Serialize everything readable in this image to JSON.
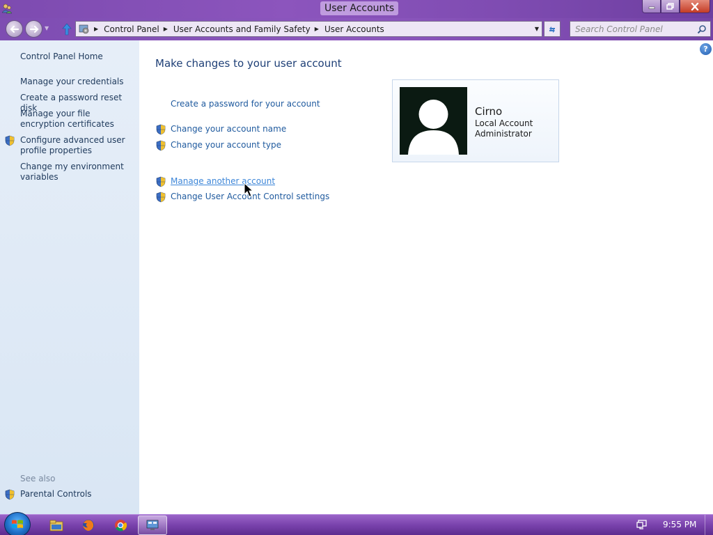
{
  "window": {
    "title": "User Accounts"
  },
  "navigation": {
    "breadcrumbs": [
      "Control Panel",
      "User Accounts and Family Safety",
      "User Accounts"
    ],
    "search_placeholder": "Search Control Panel"
  },
  "sidebar": {
    "home": "Control Panel Home",
    "links": [
      "Manage your credentials",
      "Create a password reset disk",
      "Manage your file encryption certificates",
      "Configure advanced user profile properties",
      "Change my environment variables"
    ],
    "see_also_heading": "See also",
    "see_also_links": [
      "Parental Controls"
    ]
  },
  "main": {
    "heading": "Make changes to your user account",
    "tasks": [
      "Create a password for your account",
      "Change your account name",
      "Change your account type"
    ],
    "more_tasks": [
      "Manage another account",
      "Change User Account Control settings"
    ],
    "help_label": "?"
  },
  "account": {
    "name": "Cirno",
    "type": "Local Account",
    "role": "Administrator"
  },
  "taskbar": {
    "clock": "9:55 PM",
    "pinned": [
      "file-explorer-icon",
      "firefox-icon",
      "chrome-icon",
      "control-panel-icon"
    ]
  },
  "colors": {
    "accent_purple": "#8c55bd",
    "link_blue": "#1f5a9e",
    "heading_blue": "#1e3f76",
    "sidebar_bg": "#e6eef8"
  }
}
